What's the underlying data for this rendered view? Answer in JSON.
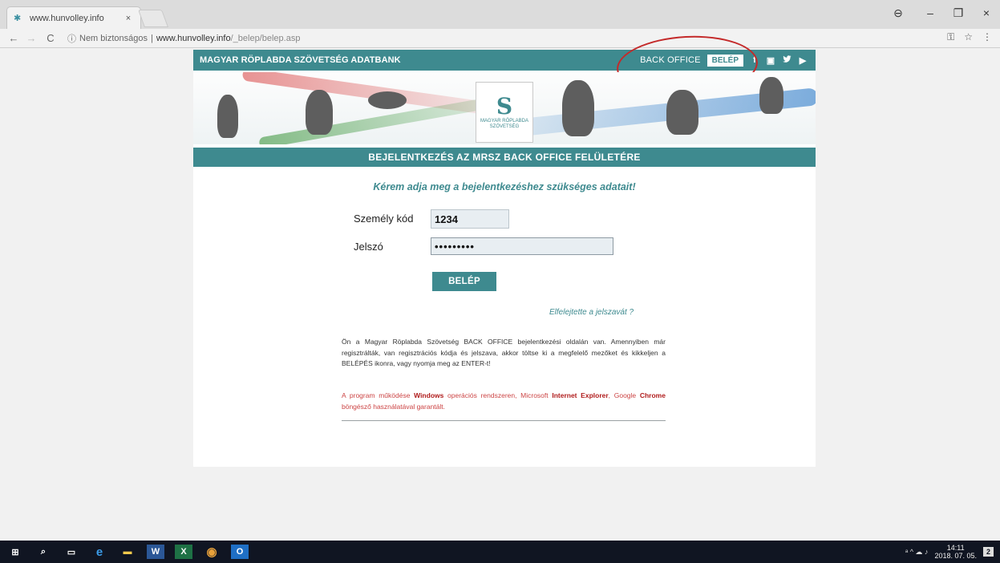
{
  "browser": {
    "tab_title": "www.hunvolley.info",
    "tab_close": "×",
    "url_security": "Nem biztonságos",
    "url_host": "www.hunvolley.info",
    "url_path": "/_belep/belep.asp",
    "nav": {
      "back": "←",
      "forward": "→",
      "reload": "C"
    },
    "controls": {
      "account": "⊖",
      "minimize": "–",
      "maximize": "❐",
      "close": "×"
    },
    "addr_icons": {
      "key": "⚿",
      "star": "☆",
      "menu": "⋮"
    }
  },
  "site": {
    "brand": "MAGYAR RÖPLABDA SZÖVETSÉG ADATBANK",
    "back_office_label": "BACK OFFICE",
    "belep_top": "BELÉP",
    "social": {
      "facebook": "f",
      "instagram": "▣",
      "twitter": "🐦",
      "youtube": "▶"
    },
    "logo_mark": "S",
    "logo_text": "MAGYAR RÖPLABDA SZÖVETSÉG",
    "page_title": "BEJELENTKEZÉS AZ MRSZ BACK OFFICE FELÜLETÉRE",
    "instruction": "Kérem adja meg a bejelentkezéshez szükséges adatait!"
  },
  "form": {
    "user_label": "Személy kód",
    "user_value": "1234",
    "password_label": "Jelszó",
    "password_value": "•••••••••",
    "submit_label": "BELÉP",
    "forgot_link": "Elfelejtette a jelszavát ?"
  },
  "info": {
    "paragraph": "Ön a Magyar Röplabda Szövetség BACK OFFICE bejelentkezési oldalán van. Amennyiben már regisztrálták, van regisztrációs kódja és jelszava, akkor töltse ki a megfelelő mezőket és kikkeljen a BELÉPÉS ikonra, vagy nyomja meg az ENTER-t!",
    "req_1": "A program működése",
    "req_windows": "Windows",
    "req_2": "operációs rendszeren, Microsoft",
    "req_ie": "Internet Explorer",
    "req_3": ",",
    "req_4": "Google",
    "req_chrome": "Chrome",
    "req_5": "böngésző használatával garantált."
  },
  "taskbar": {
    "icons": {
      "start": "⊞",
      "search": "⌕",
      "taskview": "▭",
      "edge": "e",
      "explorer": "▬",
      "word": "W",
      "excel": "X",
      "chrome": "◉",
      "outlook": "O"
    },
    "tray_icons": "ᵃ ^ ☁ ♪",
    "time": "14:11",
    "date": "2018. 07. 05.",
    "notif": "2"
  },
  "colors": {
    "teal": "#3e8a8f",
    "annotation_red": "#c42a2a",
    "requirement_red": "#c44444"
  }
}
